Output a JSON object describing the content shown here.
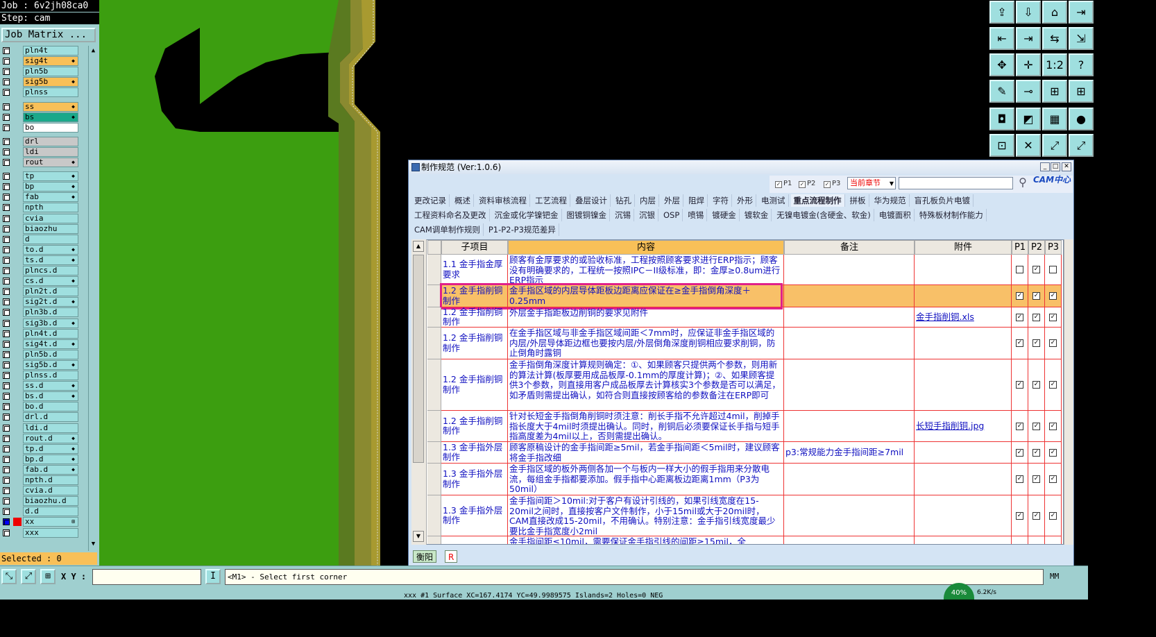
{
  "left_panel": {
    "job": "Job : 6v2jh08ca0",
    "step": "Step: cam",
    "job_matrix_btn": "Job Matrix ...",
    "selected": "Selected : 0",
    "layers": [
      {
        "name": "pln4t",
        "color": "#9fdfdf",
        "arrow": ""
      },
      {
        "name": "sig4t",
        "color": "#f8c058",
        "arrow": "◆"
      },
      {
        "name": "pln5b",
        "color": "#9fdfdf",
        "arrow": ""
      },
      {
        "name": "sig5b",
        "color": "#f8c058",
        "arrow": "◆"
      },
      {
        "name": "plnss",
        "color": "#9fdfdf",
        "arrow": ""
      },
      {
        "name": "ss",
        "color": "#f8c058",
        "arrow": "◆"
      },
      {
        "name": "bs",
        "color": "#1aa88a",
        "arrow": "◆"
      },
      {
        "name": "bo",
        "color": "#ffffff",
        "arrow": ""
      },
      {
        "name": "drl",
        "color": "#c8c8c8",
        "arrow": ""
      },
      {
        "name": "ldi",
        "color": "#c8c8c8",
        "arrow": ""
      },
      {
        "name": "rout",
        "color": "#c8c8c8",
        "arrow": "◆"
      },
      {
        "name": "tp",
        "color": "#9fdfdf",
        "arrow": "◆"
      },
      {
        "name": "bp",
        "color": "#9fdfdf",
        "arrow": "◆"
      },
      {
        "name": "fab",
        "color": "#9fdfdf",
        "arrow": "◆"
      },
      {
        "name": "npth",
        "color": "#9fdfdf",
        "arrow": ""
      },
      {
        "name": "cvia",
        "color": "#9fdfdf",
        "arrow": ""
      },
      {
        "name": "biaozhu",
        "color": "#9fdfdf",
        "arrow": ""
      },
      {
        "name": "d",
        "color": "#9fdfdf",
        "arrow": ""
      },
      {
        "name": "to.d",
        "color": "#9fdfdf",
        "arrow": "◆"
      },
      {
        "name": "ts.d",
        "color": "#9fdfdf",
        "arrow": "◆"
      },
      {
        "name": "plncs.d",
        "color": "#9fdfdf",
        "arrow": ""
      },
      {
        "name": "cs.d",
        "color": "#9fdfdf",
        "arrow": "◆"
      },
      {
        "name": "pln2t.d",
        "color": "#9fdfdf",
        "arrow": ""
      },
      {
        "name": "sig2t.d",
        "color": "#9fdfdf",
        "arrow": "◆"
      },
      {
        "name": "pln3b.d",
        "color": "#9fdfdf",
        "arrow": ""
      },
      {
        "name": "sig3b.d",
        "color": "#9fdfdf",
        "arrow": "◆"
      },
      {
        "name": "pln4t.d",
        "color": "#9fdfdf",
        "arrow": ""
      },
      {
        "name": "sig4t.d",
        "color": "#9fdfdf",
        "arrow": "◆"
      },
      {
        "name": "pln5b.d",
        "color": "#9fdfdf",
        "arrow": ""
      },
      {
        "name": "sig5b.d",
        "color": "#9fdfdf",
        "arrow": "◆"
      },
      {
        "name": "plnss.d",
        "color": "#9fdfdf",
        "arrow": ""
      },
      {
        "name": "ss.d",
        "color": "#9fdfdf",
        "arrow": "◆"
      },
      {
        "name": "bs.d",
        "color": "#9fdfdf",
        "arrow": "◆"
      },
      {
        "name": "bo.d",
        "color": "#9fdfdf",
        "arrow": ""
      },
      {
        "name": "drl.d",
        "color": "#9fdfdf",
        "arrow": ""
      },
      {
        "name": "ldi.d",
        "color": "#9fdfdf",
        "arrow": ""
      },
      {
        "name": "rout.d",
        "color": "#9fdfdf",
        "arrow": "◆"
      },
      {
        "name": "tp.d",
        "color": "#9fdfdf",
        "arrow": "◆"
      },
      {
        "name": "bp.d",
        "color": "#9fdfdf",
        "arrow": "◆"
      },
      {
        "name": "fab.d",
        "color": "#9fdfdf",
        "arrow": "◆"
      },
      {
        "name": "npth.d",
        "color": "#9fdfdf",
        "arrow": ""
      },
      {
        "name": "cvia.d",
        "color": "#9fdfdf",
        "arrow": ""
      },
      {
        "name": "biaozhu.d",
        "color": "#9fdfdf",
        "arrow": ""
      },
      {
        "name": "d.d",
        "color": "#9fdfdf",
        "arrow": ""
      },
      {
        "name": "xx",
        "color": "#9fdfdf",
        "arrow": "⊞",
        "red": true
      },
      {
        "name": "xxx",
        "color": "#9fdfdf",
        "arrow": ""
      }
    ]
  },
  "toolbar_icons": [
    "arrow-up-box-icon",
    "arrow-down-box-icon",
    "home-box-icon",
    "export-icon",
    "zoom-home-icon",
    "zoom-in-icon",
    "zoom-out-icon",
    "zoom-fit-icon",
    "fit-screen-icon",
    "center-icon",
    "one-to-one-icon",
    "help-icon",
    "measure-icon",
    "snap-icon",
    "grid-icon",
    "layers-icon",
    "select-icon",
    "redraw-icon",
    "ruler-icon",
    "dot-icon",
    "connect-icon",
    "cross-icon",
    "route-icon",
    "net-icon"
  ],
  "toolbar_labels": [
    "⇪",
    "⇩",
    "⌂",
    "⇥",
    "⇤",
    "⇥",
    "⇆",
    "⇲",
    "✥",
    "✛",
    "1:2",
    "?",
    "✎",
    "⊸",
    "⊞",
    "⊞",
    "◘",
    "◩",
    "▦",
    "●",
    "⊡",
    "✕",
    "⤢",
    "⤢"
  ],
  "dialog": {
    "title": "制作规范 (Ver:1.0.6)",
    "filters": [
      {
        "label": "P1",
        "checked": true
      },
      {
        "label": "P2",
        "checked": true
      },
      {
        "label": "P3",
        "checked": true
      }
    ],
    "chapter_select": "当前章节",
    "search_placeholder": "",
    "logo": "CAM中心",
    "tabs_row1": [
      "更改记录",
      "概述",
      "资料审核流程",
      "工艺流程",
      "叠层设计",
      "钻孔",
      "内层",
      "外层",
      "阻焊",
      "字符",
      "外形",
      "电测试",
      "重点流程制作",
      "拼板",
      "华为规范",
      "盲孔板负片电镀"
    ],
    "tabs_row2": [
      "工程资料命名及更改",
      "沉金或化学镍钯金",
      "图镀铜镍金",
      "沉锡",
      "沉银",
      "OSP",
      "喷锡",
      "镀硬金",
      "镀软金",
      "无镍电镀金(含硬金、软金)",
      "电镀面积",
      "特殊板材制作能力"
    ],
    "tabs_row3": [
      "CAM调单制作规则",
      "P1-P2-P3规范差异"
    ],
    "active_tab": "重点流程制作",
    "columns": [
      "子项目",
      "内容",
      "备注",
      "附件",
      "P1",
      "P2",
      "P3"
    ],
    "rows": [
      {
        "sub": "1.1 金手指金厚要求",
        "content": "顾客有金厚要求的或验收标准，工程按照顾客要求进行ERP指示；顾客没有明确要求的，工程统一按照IPC－II级标准，即：金厚≥0.8um进行ERP指示",
        "note": "",
        "attach": "",
        "p": [
          false,
          true,
          false
        ],
        "h": 44
      },
      {
        "sub": "1.2 金手指削铜制作",
        "content": "金手指区域的内层导体距板边距离应保证在≥金手指倒角深度＋0.25mm",
        "note": "",
        "attach": "",
        "p": [
          true,
          true,
          true
        ],
        "h": 32,
        "hl": true
      },
      {
        "sub": "1.2 金手指削铜制作",
        "content": "外层金手指距板边削铜的要求见附件",
        "note": "",
        "attach": "金手指削铜.xls",
        "p": [
          true,
          true,
          true
        ],
        "h": 29
      },
      {
        "sub": "1.2 金手指削铜制作",
        "content": "在金手指区域与非金手指区域间距＜7mm时，应保证非金手指区域的内层/外层导体距边框也要按内层/外层倒角深度削铜相应要求削铜，防止倒角时露铜",
        "note": "",
        "attach": "",
        "p": [
          true,
          true,
          true
        ],
        "h": 46
      },
      {
        "sub": "1.2 金手指削铜制作",
        "content": "金手指倒角深度计算规则确定：①、如果顾客只提供两个参数，则用新的算法计算(板厚要用成品板厚-0.1mm的厚度计算)；②、如果顾客提供3个参数，则直接用客户成品板厚去计算核实3个参数是否可以满足，如矛盾则需提出确认，如符合则直接按顾客给的参数备注在ERP即可",
        "note": "",
        "attach": "",
        "p": [
          true,
          true,
          true
        ],
        "h": 74
      },
      {
        "sub": "1.2 金手指削铜制作",
        "content": "针对长短金手指倒角削铜时须注意：削长手指不允许超过4mil，削掉手指长度大于4mil时须提出确认。同时，削铜后必须要保证长手指与短手指高度差为4mil以上，否则需提出确认。",
        "note": "",
        "attach": "长短手指削铜.jpg",
        "p": [
          true,
          true,
          true
        ],
        "h": 45
      },
      {
        "sub": "1.3 金手指外层制作",
        "content": "顾客原稿设计的金手指间距≥5mil，若金手指间距＜5mil时，建议顾客将金手指改细",
        "note": "p3:常规能力金手指间距≥7mil",
        "attach": "",
        "p": [
          true,
          true,
          true
        ],
        "h": 31
      },
      {
        "sub": "1.3 金手指外层制作",
        "content": "金手指区域的板外两侧各加一个与板内一样大小的假手指用来分散电流，每组金手指都要添加。假手指中心距离板边距离1mm（P3为50mil）",
        "note": "",
        "attach": "",
        "p": [
          true,
          true,
          true
        ],
        "h": 46
      },
      {
        "sub": "1.3 金手指外层制作",
        "content": "金手指间距＞10mil:对于客户有设计引线的，如果引线宽度在15-20mil之间时，直接按客户文件制作，小于15mil或大于20mil时，CAM直接改成15-20mil，不用确认。特别注意：金手指引线宽度最少要比金手指宽度小2mil",
        "note": "",
        "attach": "",
        "p": [
          true,
          true,
          true
        ],
        "h": 59
      },
      {
        "sub": "",
        "content": "金手指间距≤10mil，需要保证金手指引线的间距≥15mil，全",
        "note": "",
        "attach": "",
        "p": [
          false,
          false,
          false
        ],
        "h": 14
      }
    ],
    "footer_tabs": [
      "衡阳",
      "R"
    ]
  },
  "bottom": {
    "xy_label": "X Y :",
    "xy_value": "",
    "message": "<M1> - Select first corner",
    "units": "MM",
    "status": "xxx #1 Surface XC=167.4174 YC=49.9989575 Islands=2 Holes=0 NEG",
    "net_percent": "40%",
    "net_speed": "6.2K/s"
  },
  "colors": {
    "board_green": "#3c9e10",
    "panel": "#9fcfcf",
    "highlight": "#f8c068",
    "grid_red": "#e03030"
  }
}
